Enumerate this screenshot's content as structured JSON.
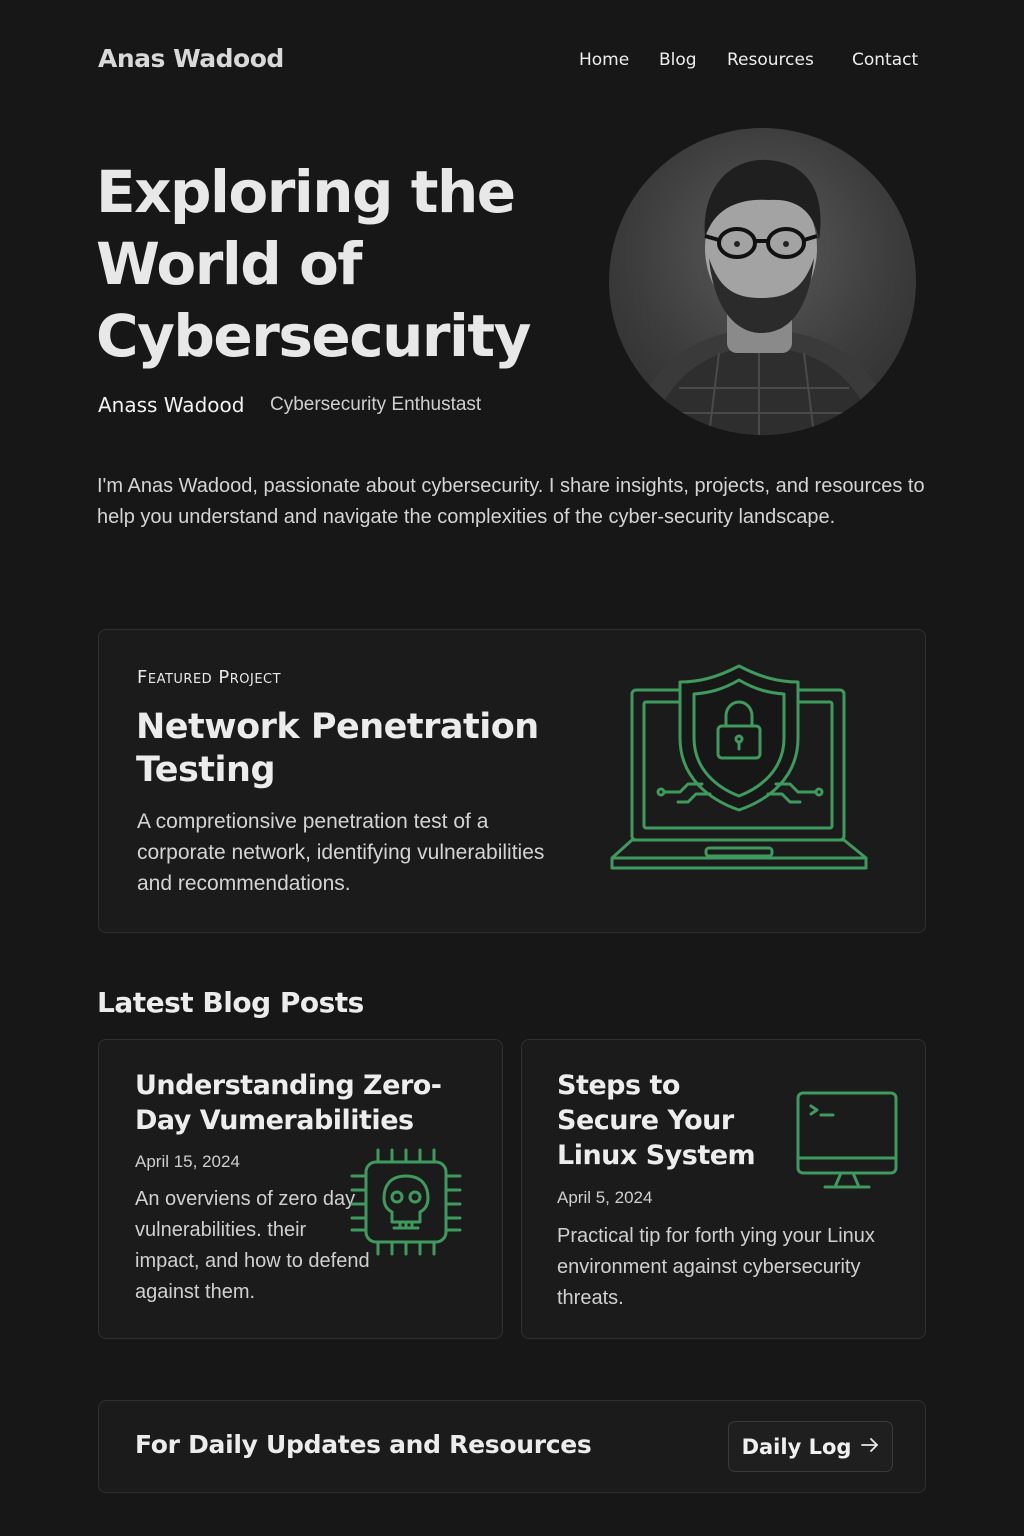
{
  "header": {
    "brand": "Anas Wadood",
    "nav": [
      "Home",
      "Blog",
      "Resources",
      "Contact"
    ]
  },
  "hero": {
    "title_lines": [
      "Exploring the",
      "World of",
      "Cybersecurity"
    ],
    "author_name": "Anass Wadood",
    "author_role": "Cybersecurity Enthustast",
    "intro": "I'm Anas Wadood, passionate about cybersecurity. I share insights, projects, and resources to help you understand and navigate the complexities of the cyber-security landscape."
  },
  "featured": {
    "eyebrow": "Featured Project",
    "title": "Network Penetration Testing",
    "description": "A compretionsive penetration test of a corporate network, identifying vulnerabilities and recommendations.",
    "icon": "laptop-shield-lock-icon"
  },
  "blog": {
    "section_title": "Latest Blog Posts",
    "posts": [
      {
        "title": "Understanding Zero-Day Vumerabilities",
        "date": "April 15, 2024",
        "description": "An overviens of zero day vulnerabilities. their impact, and how to defend against them.",
        "icon": "chip-skull-icon"
      },
      {
        "title": "Steps to Secure Your Linux System",
        "date": "April 5, 2024",
        "description": "Practical tip for forth ying your Linux environment against cybersecurity threats.",
        "icon": "monitor-terminal-icon"
      }
    ]
  },
  "cta": {
    "text": "For Daily Updates and Resources",
    "button_label": "Daily Log",
    "button_icon": "arrow-right-icon"
  },
  "colors": {
    "background": "#171717",
    "card": "#1b1b1b",
    "accent_green": "#3f9a5e"
  }
}
